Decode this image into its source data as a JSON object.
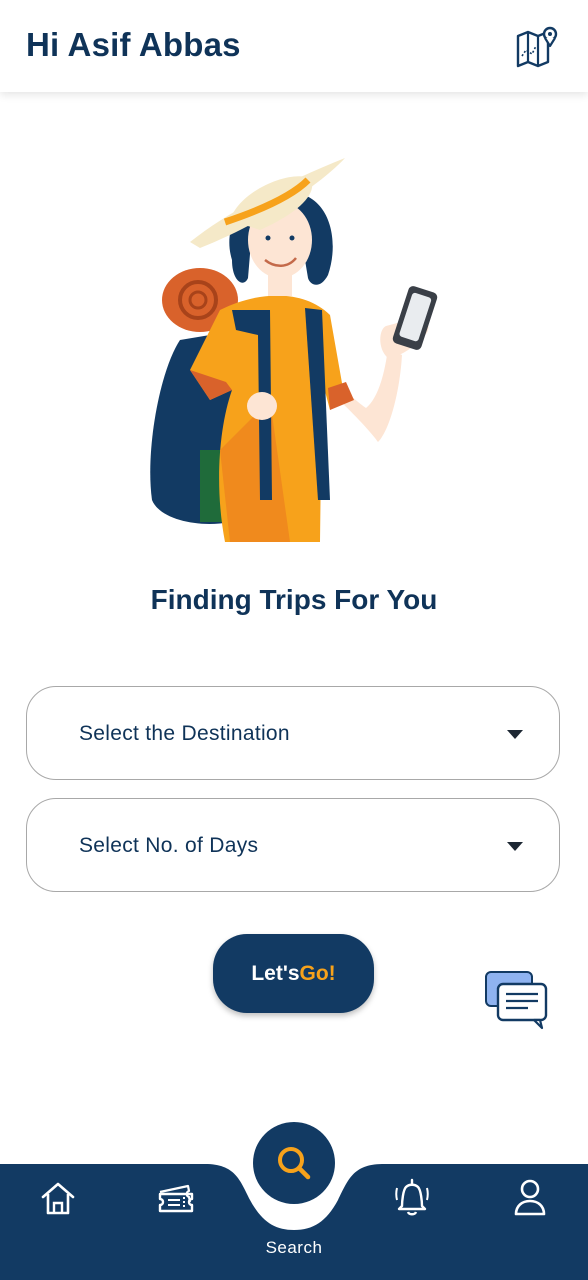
{
  "header": {
    "greeting": "Hi Asif Abbas",
    "map_icon": "map-location-icon"
  },
  "main": {
    "subtitle": "Finding Trips For You",
    "destination_select": {
      "label": "Select the Destination",
      "icon": "caret-down-icon"
    },
    "days_select": {
      "label": "Select No. of Days",
      "icon": "caret-down-icon"
    },
    "go_button": {
      "label_part1": "Let's ",
      "label_part2": "Go!"
    },
    "chat_icon": "chat-bubbles-icon"
  },
  "bottom_nav": {
    "items": [
      {
        "icon": "home-icon"
      },
      {
        "icon": "ticket-icon"
      },
      {
        "icon": "search-icon",
        "label": "Search",
        "active": true
      },
      {
        "icon": "bell-icon"
      },
      {
        "icon": "user-icon"
      }
    ]
  },
  "colors": {
    "primary": "#123a63",
    "accent": "#f7a21b",
    "text": "#0f3358",
    "border": "#a8a8a8"
  }
}
